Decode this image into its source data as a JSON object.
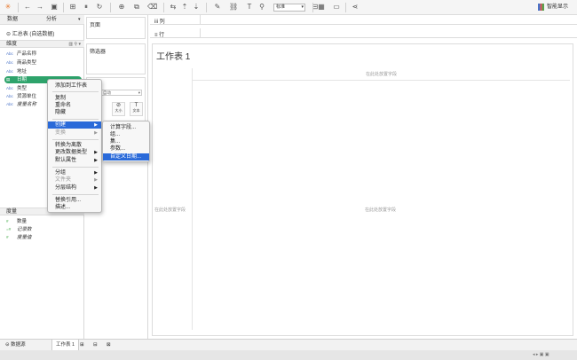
{
  "toolbar": {
    "icons": [
      "tableau-logo-icon",
      "back-icon",
      "forward-icon",
      "save-icon",
      "new-datasource-icon",
      "pause-icon",
      "refresh-icon",
      "new-sheet-icon",
      "duplicate-icon",
      "clear-icon",
      "swap-icon",
      "sort-asc-icon",
      "sort-desc-icon",
      "group-icon",
      "label-icon",
      "pin-icon",
      "fit-icon",
      "highlight-icon",
      "fix-axes-icon",
      "show-me-icon",
      "presentation-icon",
      "share-icon"
    ],
    "fit_select": "标准",
    "smart_display": "智能显示"
  },
  "left_panel": {
    "tab_data": "数据",
    "tab_analysis": "分析",
    "datasource": "汇总表 (自选数据)",
    "dimensions_header": "维度",
    "dimensions": [
      {
        "type": "Abc",
        "label": "产品名称"
      },
      {
        "type": "Abc",
        "label": "商品类型"
      },
      {
        "type": "Abc",
        "label": "地址"
      },
      {
        "type": "date",
        "label": "日期"
      },
      {
        "type": "Abc",
        "label": "类型"
      },
      {
        "type": "Abc",
        "label": "货源单位"
      },
      {
        "type": "Abc",
        "label": "度量名称"
      }
    ],
    "measures_header": "度量",
    "measures": [
      {
        "type": "#",
        "label": "数量"
      },
      {
        "type": "=#",
        "label": "记录数"
      },
      {
        "type": "#",
        "label": "度量值"
      }
    ]
  },
  "middle_panel": {
    "pages": "页面",
    "filters": "筛选器",
    "marks_select": "自动",
    "size_label": "大小",
    "text_label": "文本"
  },
  "main": {
    "columns_label": "列",
    "rows_label": "行",
    "sheet_title": "工作表 1",
    "drop_field_top": "在此处放置字段",
    "drop_field_left": "在此处放置字段",
    "drop_field_center": "在此处放置字段"
  },
  "bottom": {
    "datasource_tab": "数据源",
    "sheet_tab": "工作表 1"
  },
  "context_menu": {
    "items": [
      {
        "label": "添加到工作表"
      },
      {
        "label": "复制"
      },
      {
        "label": "重命名"
      },
      {
        "label": "隐藏"
      },
      {
        "label": "创建"
      },
      {
        "label": "变换"
      },
      {
        "label": "转换为离散"
      },
      {
        "label": "更改数据类型"
      },
      {
        "label": "默认属性"
      },
      {
        "label": "分组"
      },
      {
        "label": "文件夹"
      },
      {
        "label": "分层结构"
      },
      {
        "label": "替换引用..."
      },
      {
        "label": "描述..."
      }
    ]
  },
  "submenu": {
    "items": [
      {
        "label": "计算字段..."
      },
      {
        "label": "组..."
      },
      {
        "label": "集..."
      },
      {
        "label": "参数..."
      },
      {
        "label": "自定义日期..."
      }
    ]
  }
}
